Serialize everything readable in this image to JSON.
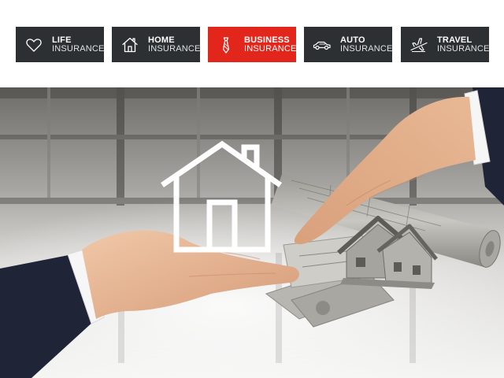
{
  "nav": {
    "tabs": [
      {
        "line1": "LIFE",
        "line2": "INSURANCE",
        "icon": "heart-icon"
      },
      {
        "line1": "HOME",
        "line2": "INSURANCE",
        "icon": "house-icon"
      },
      {
        "line1": "BUSINESS",
        "line2": "INSURANCE",
        "icon": "necktie-icon",
        "active": true
      },
      {
        "line1": "AUTO",
        "line2": "INSURANCE",
        "icon": "car-icon"
      },
      {
        "line1": "TRAVEL",
        "line2": "INSURANCE",
        "icon": "airplane-icon"
      }
    ]
  },
  "colors": {
    "tab_bg": "#2c3033",
    "tab_active_bg": "#e3261b",
    "tab_text": "#ffffff"
  }
}
